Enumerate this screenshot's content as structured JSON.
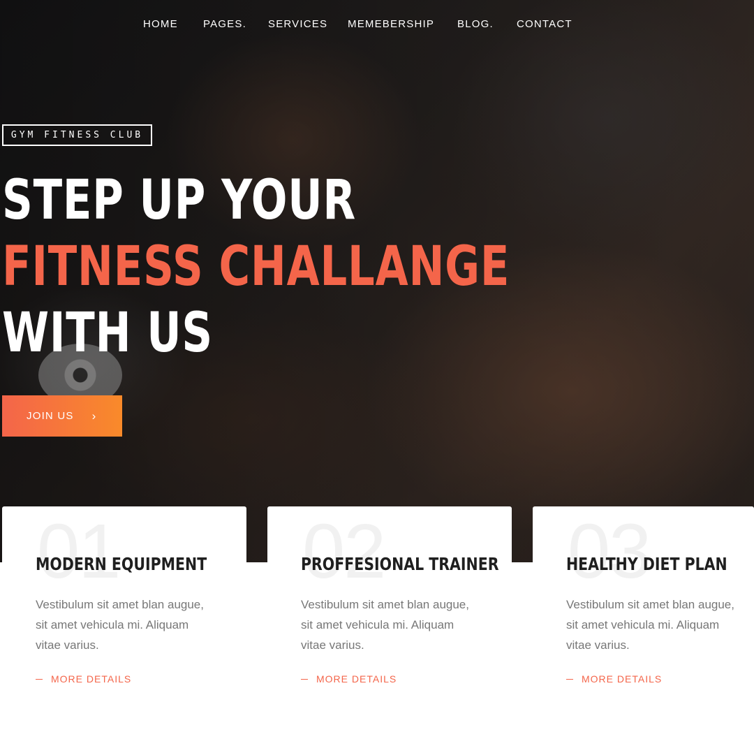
{
  "nav": {
    "items": [
      "HOME",
      "PAGES.",
      "SERVICES",
      "MEMEBERSHIP",
      "BLOG.",
      "CONTACT"
    ]
  },
  "hero": {
    "badge": "GYM FITNESS CLUB",
    "headline_line1": "STEP UP YOUR",
    "headline_line2": "FITNESS CHALLANGE",
    "headline_line3": "WITH US",
    "join_label": "JOIN US",
    "join_icon": "chevron-right-icon"
  },
  "features": [
    {
      "number": "01",
      "title": "MODERN EQUIPMENT",
      "text": "Vestibulum sit amet blan augue, sit amet vehicula mi. Aliquam vitae varius.",
      "link": "MORE DETAILS"
    },
    {
      "number": "02",
      "title": "PROFFESIONAL TRAINER",
      "text": "Vestibulum sit amet blan augue, sit amet vehicula mi. Aliquam vitae varius.",
      "link": "MORE DETAILS"
    },
    {
      "number": "03",
      "title": "HEALTHY DIET PLAN",
      "text": "Vestibulum sit amet blan augue, sit amet vehicula mi. Aliquam vitae varius.",
      "link": "MORE DETAILS"
    }
  ],
  "colors": {
    "accent": "#f4654a",
    "accent_gradient_end": "#f98a2a",
    "heading_dark": "#1f1f1f",
    "body_text": "#777777"
  }
}
